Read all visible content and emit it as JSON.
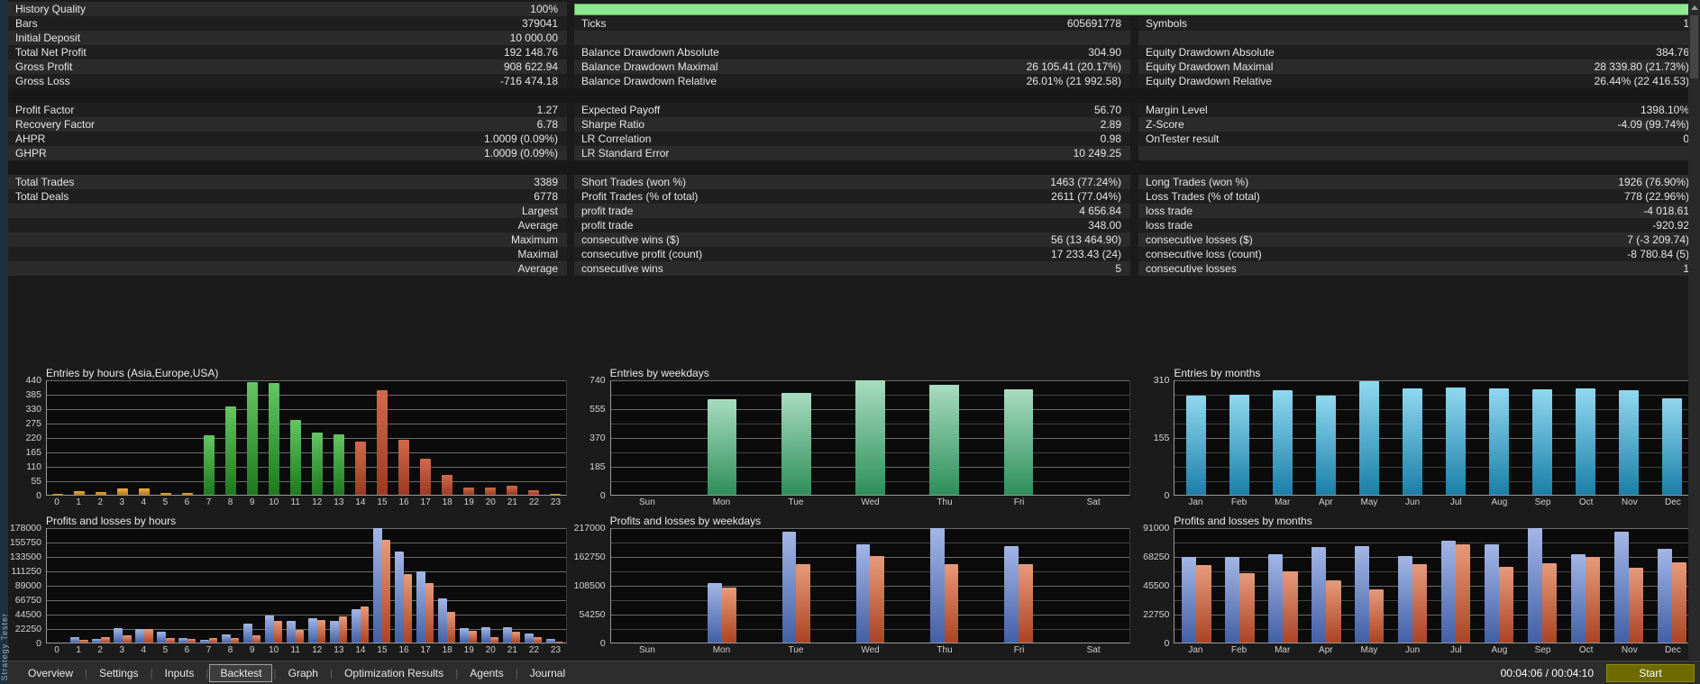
{
  "app": {
    "panel_label": "Strategy Tester"
  },
  "palette": {
    "progress_green": "#90e88e",
    "asia": [
      "#f2b13e",
      "#b87614"
    ],
    "europe": [
      "#63c663",
      "#1d7a1d"
    ],
    "usa": [
      "#d06a4b",
      "#9c3a21"
    ],
    "weekday_green": [
      "#a8dcc0",
      "#2e8f5a"
    ],
    "month_blue": [
      "#90d8f0",
      "#1b7fa8"
    ],
    "profit_blue": [
      "#a3b6e6",
      "#4360a6"
    ],
    "loss_red": [
      "#e69b7b",
      "#aa4425"
    ]
  },
  "stats": {
    "rows": [
      {
        "c1l": "History Quality",
        "c1v": "100%",
        "progress": true
      },
      {
        "c1l": "Bars",
        "c1v": "379041",
        "c2l": "Ticks",
        "c2v": "605691778",
        "c3l": "Symbols",
        "c3v": "1"
      },
      {
        "c1l": "Initial Deposit",
        "c1v": "10 000.00",
        "c2l": "",
        "c2v": "",
        "c3l": "",
        "c3v": ""
      },
      {
        "c1l": "Total Net Profit",
        "c1v": "192 148.76",
        "c2l": "Balance Drawdown Absolute",
        "c2v": "304.90",
        "c3l": "Equity Drawdown Absolute",
        "c3v": "384.76"
      },
      {
        "c1l": "Gross Profit",
        "c1v": "908 622.94",
        "c2l": "Balance Drawdown Maximal",
        "c2v": "26 105.41 (20.17%)",
        "c3l": "Equity Drawdown Maximal",
        "c3v": "28 339.80 (21.73%)"
      },
      {
        "c1l": "Gross Loss",
        "c1v": "-716 474.18",
        "c2l": "Balance Drawdown Relative",
        "c2v": "26.01% (21 992.58)",
        "c3l": "Equity Drawdown Relative",
        "c3v": "26.44% (22 416.53)"
      },
      {
        "blank": true,
        "sep": true
      },
      {
        "c1l": "Profit Factor",
        "c1v": "1.27",
        "c2l": "Expected Payoff",
        "c2v": "56.70",
        "c3l": "Margin Level",
        "c3v": "1398.10%"
      },
      {
        "c1l": "Recovery Factor",
        "c1v": "6.78",
        "c2l": "Sharpe Ratio",
        "c2v": "2.89",
        "c3l": "Z-Score",
        "c3v": "-4.09 (99.74%)"
      },
      {
        "c1l": "AHPR",
        "c1v": "1.0009 (0.09%)",
        "c2l": "LR Correlation",
        "c2v": "0.98",
        "c3l": "OnTester result",
        "c3v": "0"
      },
      {
        "c1l": "GHPR",
        "c1v": "1.0009 (0.09%)",
        "c2l": "LR Standard Error",
        "c2v": "10 249.25",
        "c3l": "",
        "c3v": ""
      },
      {
        "blank": true,
        "sep": true
      },
      {
        "c1l": "Total Trades",
        "c1v": "3389",
        "c2l": "Short Trades (won %)",
        "c2v": "1463 (77.24%)",
        "c3l": "Long Trades (won %)",
        "c3v": "1926 (76.90%)"
      },
      {
        "c1l": "Total Deals",
        "c1v": "6778",
        "c2l": "Profit Trades (% of total)",
        "c2v": "2611 (77.04%)",
        "c3l": "Loss Trades (% of total)",
        "c3v": "778 (22.96%)"
      },
      {
        "c1l": "",
        "c1v": "Largest",
        "c2l": "profit trade",
        "c2v": "4 656.84",
        "c3l": "loss trade",
        "c3v": "-4 018.61"
      },
      {
        "c1l": "",
        "c1v": "Average",
        "c2l": "profit trade",
        "c2v": "348.00",
        "c3l": "loss trade",
        "c3v": "-920.92"
      },
      {
        "c1l": "",
        "c1v": "Maximum",
        "c2l": "consecutive wins ($)",
        "c2v": "56 (13 464.90)",
        "c3l": "consecutive losses ($)",
        "c3v": "7 (-3 209.74)"
      },
      {
        "c1l": "",
        "c1v": "Maximal",
        "c2l": "consecutive profit (count)",
        "c2v": "17 233.43 (24)",
        "c3l": "consecutive loss (count)",
        "c3v": "-8 780.84 (5)"
      },
      {
        "c1l": "",
        "c1v": "Average",
        "c2l": "consecutive wins",
        "c2v": "5",
        "c3l": "consecutive losses",
        "c3v": "1"
      },
      {
        "blank": true
      },
      {
        "blank": true
      },
      {
        "blank": true
      },
      {
        "blank": true
      },
      {
        "blank": true
      },
      {
        "blank": true
      }
    ]
  },
  "chart_data": [
    {
      "id": "entries-by-hours",
      "type": "bar",
      "title": "Entries by hours (Asia,Europe,USA)",
      "categories": [
        "0",
        "1",
        "2",
        "3",
        "4",
        "5",
        "6",
        "7",
        "8",
        "9",
        "10",
        "11",
        "12",
        "13",
        "14",
        "15",
        "16",
        "17",
        "18",
        "19",
        "20",
        "21",
        "22",
        "23"
      ],
      "values": [
        2,
        15,
        11,
        25,
        23,
        7,
        8,
        228,
        338,
        432,
        428,
        287,
        240,
        231,
        204,
        401,
        211,
        139,
        76,
        28,
        27,
        33,
        18,
        4
      ],
      "bar_groups": [
        "asia",
        "asia",
        "asia",
        "asia",
        "asia",
        "asia",
        "asia",
        "europe",
        "europe",
        "europe",
        "europe",
        "europe",
        "europe",
        "europe",
        "usa",
        "usa",
        "usa",
        "usa",
        "usa",
        "usa",
        "usa",
        "usa",
        "usa",
        "asia"
      ],
      "ymax": 440,
      "yticks": [
        440,
        385,
        330,
        275,
        220,
        165,
        110,
        55,
        0
      ],
      "bar_pct": 50
    },
    {
      "id": "entries-by-weekdays",
      "type": "bar",
      "title": "Entries by weekdays",
      "categories": [
        "Sun",
        "Mon",
        "Tue",
        "Wed",
        "Thu",
        "Fri",
        "Sat"
      ],
      "values": [
        0,
        620,
        660,
        740,
        710,
        680,
        0
      ],
      "color": "weekday_green",
      "ymax": 740,
      "yticks": [
        740,
        555,
        370,
        185,
        0
      ],
      "bar_pct": 40
    },
    {
      "id": "entries-by-months",
      "type": "bar",
      "title": "Entries by months",
      "categories": [
        "Jan",
        "Feb",
        "Mar",
        "Apr",
        "May",
        "Jun",
        "Jul",
        "Aug",
        "Sep",
        "Oct",
        "Nov",
        "Dec"
      ],
      "values": [
        268,
        270,
        283,
        268,
        307,
        288,
        290,
        287,
        285,
        288,
        284,
        262
      ],
      "color": "month_blue",
      "ymax": 310,
      "yticks": [
        310,
        155,
        0
      ],
      "bar_pct": 46
    },
    {
      "id": "pl-by-hours",
      "type": "bar-pair",
      "title": "Profits and losses by hours",
      "categories": [
        "0",
        "1",
        "2",
        "3",
        "4",
        "5",
        "6",
        "7",
        "8",
        "9",
        "10",
        "11",
        "12",
        "13",
        "14",
        "15",
        "16",
        "17",
        "18",
        "19",
        "20",
        "21",
        "22",
        "23"
      ],
      "series": [
        {
          "name": "profit",
          "color": "profit_blue",
          "values": [
            0,
            8000,
            5500,
            22500,
            20500,
            17500,
            7500,
            4500,
            13000,
            30000,
            41500,
            33500,
            37500,
            34000,
            52000,
            178000,
            142000,
            110500,
            68000,
            22000,
            24000,
            24000,
            14500,
            5500
          ]
        },
        {
          "name": "loss",
          "color": "loss_red",
          "values": [
            0,
            4500,
            8500,
            11000,
            21500,
            6500,
            6000,
            7000,
            6500,
            11500,
            33000,
            20000,
            34500,
            41000,
            56500,
            160000,
            106500,
            93000,
            48000,
            18500,
            8000,
            17500,
            9000,
            1000
          ]
        }
      ],
      "ymax": 178000,
      "yticks": [
        178000,
        155750,
        133500,
        111250,
        89000,
        66750,
        44500,
        22250,
        0
      ],
      "bar_pct": 40
    },
    {
      "id": "pl-by-weekdays",
      "type": "bar-pair",
      "title": "Profits and losses by weekdays",
      "categories": [
        "Sun",
        "Mon",
        "Tue",
        "Wed",
        "Thu",
        "Fri",
        "Sat"
      ],
      "series": [
        {
          "name": "profit",
          "color": "profit_blue",
          "values": [
            0,
            113000,
            210000,
            187000,
            217000,
            183000,
            0
          ]
        },
        {
          "name": "loss",
          "color": "loss_red",
          "values": [
            0,
            104500,
            148500,
            163500,
            148000,
            149000,
            0
          ]
        }
      ],
      "ymax": 217000,
      "yticks": [
        217000,
        162750,
        108500,
        54250,
        0
      ],
      "bar_pct": 19
    },
    {
      "id": "pl-by-months",
      "type": "bar-pair",
      "title": "Profits and losses by months",
      "categories": [
        "Jan",
        "Feb",
        "Mar",
        "Apr",
        "May",
        "Jun",
        "Jul",
        "Aug",
        "Sep",
        "Oct",
        "Nov",
        "Dec"
      ],
      "series": [
        {
          "name": "profit",
          "color": "profit_blue",
          "values": [
            68000,
            68250,
            70500,
            76000,
            76500,
            69000,
            81000,
            78000,
            91000,
            70000,
            88000,
            74500
          ]
        },
        {
          "name": "loss",
          "color": "loss_red",
          "values": [
            61500,
            55000,
            56500,
            49500,
            42500,
            62000,
            78000,
            60000,
            63000,
            68000,
            59500,
            64000
          ]
        }
      ],
      "ymax": 91000,
      "yticks": [
        91000,
        68250,
        45500,
        22750,
        0
      ],
      "bar_pct": 34
    }
  ],
  "tabs": {
    "items": [
      "Overview",
      "Settings",
      "Inputs",
      "Backtest",
      "Graph",
      "Optimization Results",
      "Agents",
      "Journal"
    ],
    "active_index": 3
  },
  "statusbar": {
    "time": "00:04:06 / 00:04:10",
    "start_label": "Start"
  }
}
